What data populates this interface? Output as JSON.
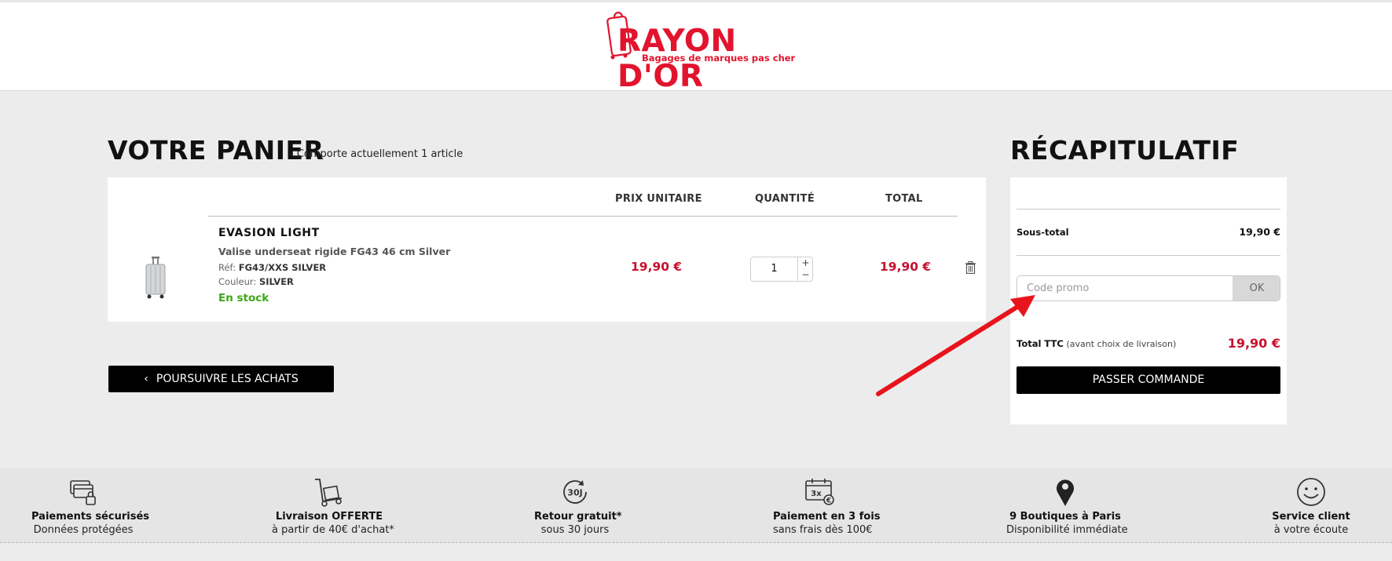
{
  "brand": {
    "name": "RAYON D'OR",
    "tagline": "Bagages de marques pas cher",
    "color": "#e2142d"
  },
  "cart": {
    "title": "VOTRE PANIER",
    "subtitle": "- Comporte actuellement 1 article",
    "columns": {
      "unit_price": "PRIX UNITAIRE",
      "quantity": "QUANTITÉ",
      "total": "TOTAL"
    },
    "item": {
      "name": "EVASION LIGHT",
      "description": "Valise underseat rigide FG43 46 cm Silver",
      "ref_label": "Réf:",
      "ref_value": "FG43/XXS SILVER",
      "color_label": "Couleur:",
      "color_value": "SILVER",
      "stock": "En stock",
      "unit_price": "19,90 €",
      "quantity": "1",
      "qty_plus": "+",
      "qty_minus": "−",
      "total": "19,90 €",
      "icon": "trash-icon"
    },
    "continue_button": "POURSUIVRE LES ACHATS"
  },
  "summary": {
    "title": "RÉCAPITULATIF",
    "subtotal_label": "Sous-total",
    "subtotal_value": "19,90 €",
    "promo_placeholder": "Code promo",
    "promo_button": "OK",
    "total_label": "Total TTC",
    "total_note": "(avant choix de livraison)",
    "total_value": "19,90 €",
    "checkout_button": "PASSER COMMANDE"
  },
  "reassurance": [
    {
      "icon": "secure-payment-icon",
      "title": "Paiements sécurisés",
      "subtitle": "Données protégées"
    },
    {
      "icon": "delivery-trolley-icon",
      "title": "Livraison OFFERTE",
      "subtitle": "à partir de 40€ d'achat*"
    },
    {
      "icon": "return-30-days-icon",
      "title": "Retour gratuit*",
      "subtitle": "sous 30 jours"
    },
    {
      "icon": "payment-3x-icon",
      "title": "Paiement en 3 fois",
      "subtitle": "sans frais dès 100€"
    },
    {
      "icon": "map-pin-icon",
      "title": "9 Boutiques à Paris",
      "subtitle": "Disponibilité immédiate"
    },
    {
      "icon": "smiley-icon",
      "title": "Service client",
      "subtitle": "à votre écoute"
    }
  ],
  "return_badge": "30J",
  "installment_badge": "3x",
  "colors": {
    "price_red": "#c8102e",
    "stock_green": "#3aa818",
    "button_black": "#000000",
    "annotation_arrow": "#e8141c"
  }
}
